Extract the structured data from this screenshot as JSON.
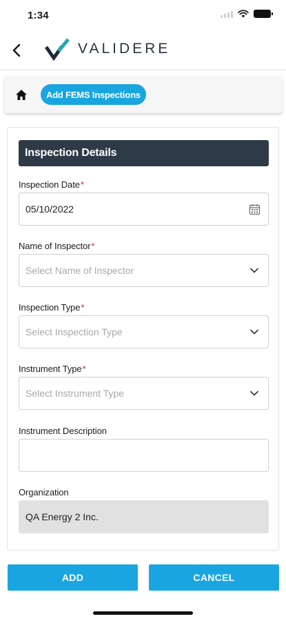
{
  "status_bar": {
    "time": "1:34"
  },
  "header": {
    "brand": "VALIDERE",
    "back_icon": "chevron-left-icon"
  },
  "breadcrumb": {
    "home_icon": "home-icon",
    "current": "Add FEMS Inspections"
  },
  "form": {
    "section_title": "Inspection Details",
    "fields": [
      {
        "label": "Inspection Date",
        "required": "*",
        "value": "05/10/2022",
        "placeholder": "",
        "icon": "calendar-icon"
      },
      {
        "label": "Name of Inspector",
        "required": "*",
        "value": "",
        "placeholder": "Select Name of Inspector",
        "icon": "chevron-down-icon"
      },
      {
        "label": "Inspection Type",
        "required": "*",
        "value": "",
        "placeholder": "Select Inspection Type",
        "icon": "chevron-down-icon"
      },
      {
        "label": "Instrument Type",
        "required": "*",
        "value": "",
        "placeholder": "Select Instrument Type",
        "icon": "chevron-down-icon"
      },
      {
        "label": "Instrument Description",
        "required": "",
        "value": "",
        "placeholder": "",
        "icon": ""
      },
      {
        "label": "Organization",
        "required": "",
        "value": "QA Energy 2 Inc.",
        "placeholder": "",
        "icon": ""
      }
    ]
  },
  "actions": {
    "add": "ADD",
    "cancel": "CANCEL"
  },
  "colors": {
    "accent": "#19a6e0",
    "section_header": "#2f3a47",
    "required": "#d22626",
    "logo_teal": "#22a7b5",
    "logo_dark": "#1f2a36"
  }
}
